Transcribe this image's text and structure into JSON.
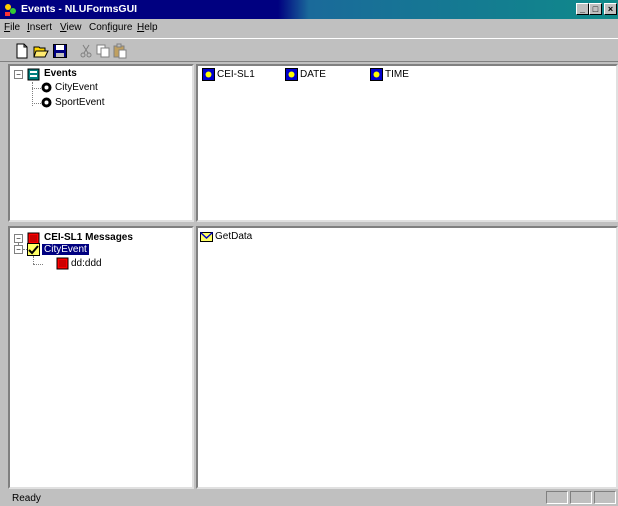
{
  "window": {
    "title": "Events - NLUFormsGUI"
  },
  "menu": [
    {
      "label": "File",
      "key": "F"
    },
    {
      "label": "Insert",
      "key": "I"
    },
    {
      "label": "View",
      "key": "V"
    },
    {
      "label": "Configure",
      "key": "C"
    },
    {
      "label": "Help",
      "key": "H"
    }
  ],
  "toolbar": {
    "buttons": [
      "new-icon",
      "open-icon",
      "save-icon",
      "cut-icon",
      "copy-icon",
      "paste-icon"
    ]
  },
  "events_tree": {
    "root": "Events",
    "children": [
      "CityEvent",
      "SportEvent"
    ]
  },
  "fields_list": {
    "items": [
      "CEI-SL1",
      "DATE",
      "TIME"
    ]
  },
  "messages_tree": {
    "root": "CEI-SL1 Messages",
    "selected": "CityEvent",
    "grandchild": "dd:ddd"
  },
  "messages_list": {
    "items": [
      "GetData"
    ]
  },
  "status": {
    "text": "Ready"
  }
}
